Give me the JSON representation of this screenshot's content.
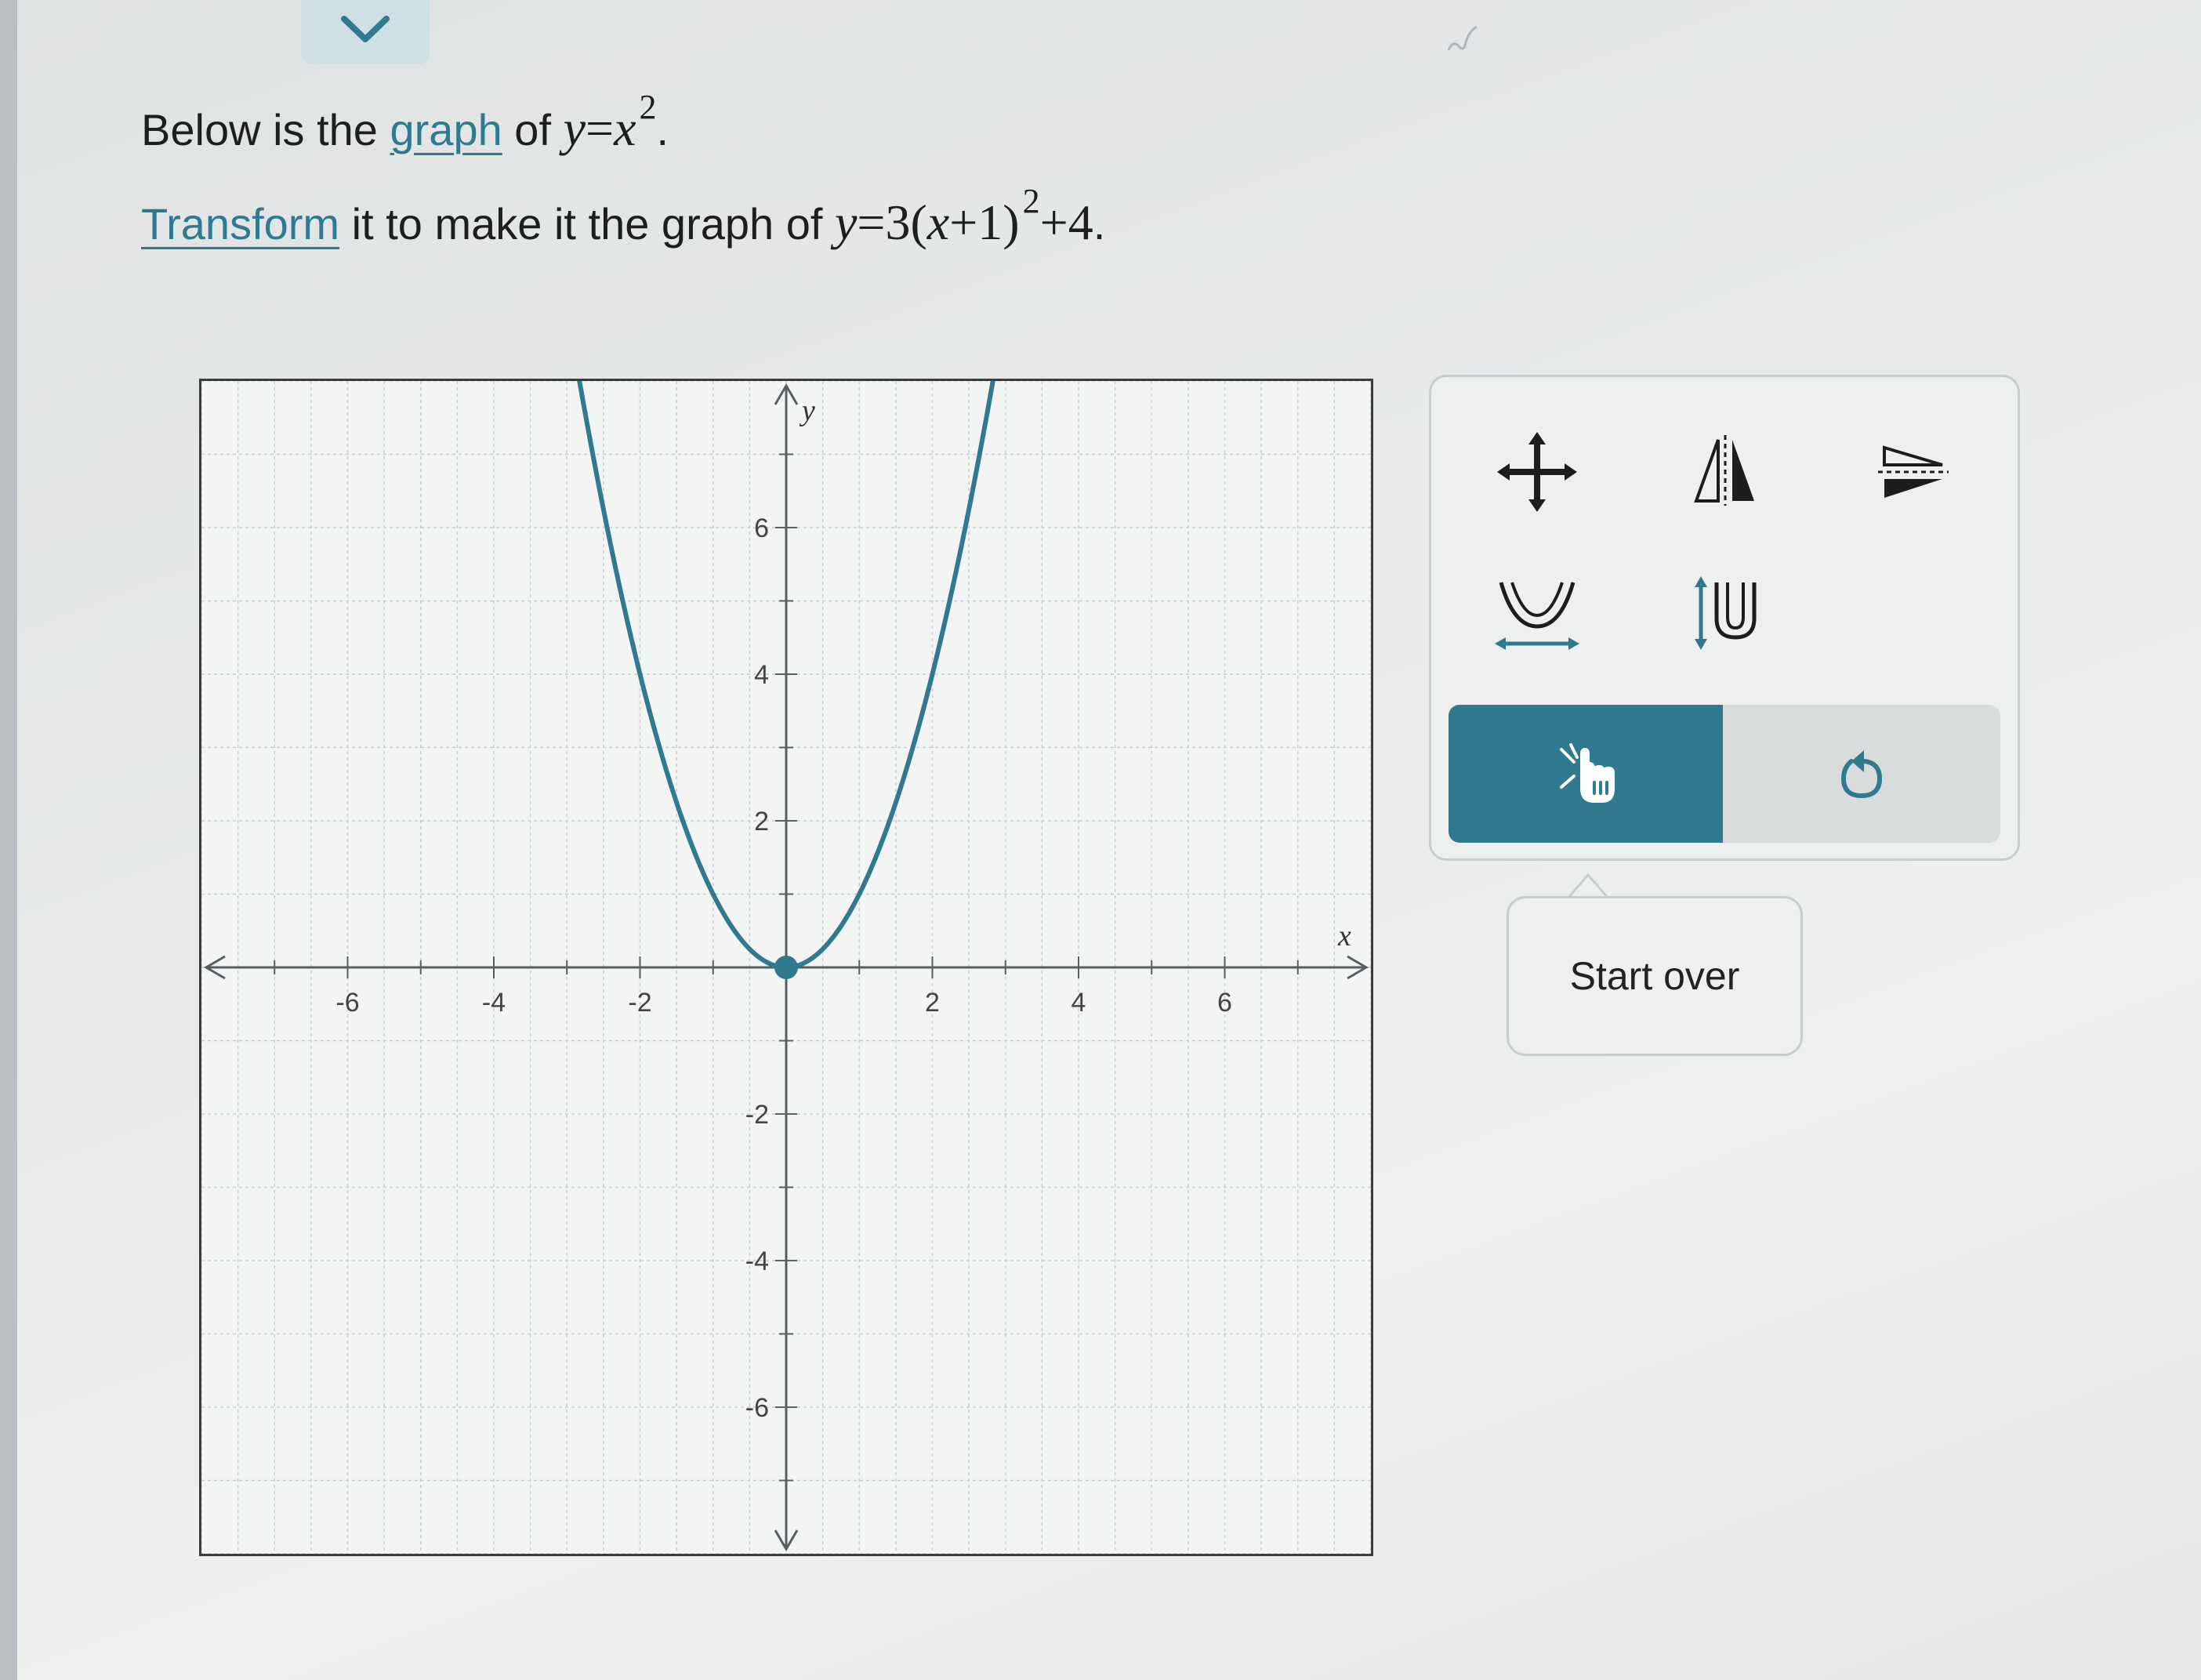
{
  "prompt": {
    "line1": {
      "before": "Below is the ",
      "link": "graph",
      "after": " of ",
      "math_var": "y",
      "math_eq": "=",
      "math_base": "x",
      "math_exp": "2",
      "end": "."
    },
    "line2": {
      "link": "Transform",
      "after": " it to make it the graph of ",
      "math_var": "y",
      "math_eq": "=3(",
      "math_x": "x",
      "math_rest": "+1)",
      "math_exp": "2",
      "math_tail": "+4",
      "end": "."
    }
  },
  "graph": {
    "x_axis_label": "x",
    "y_axis_label": "y",
    "x_ticks": [
      "-6",
      "-4",
      "-2",
      "2",
      "4",
      "6"
    ],
    "y_ticks": [
      "6",
      "4",
      "2",
      "-2",
      "-4",
      "-6"
    ],
    "xlim": [
      -8,
      8
    ],
    "ylim": [
      -8,
      8
    ],
    "curve": {
      "function": "y = x^2",
      "vertex": [
        0,
        0
      ],
      "color": "#2f7a8e"
    },
    "grid": true
  },
  "chart_data": {
    "type": "line",
    "title": "",
    "xlabel": "x",
    "ylabel": "y",
    "xlim": [
      -8,
      8
    ],
    "ylim": [
      -8,
      8
    ],
    "x": [
      -2.7,
      -2,
      -1.5,
      -1,
      -0.5,
      0,
      0.5,
      1,
      1.5,
      2,
      2.7
    ],
    "series": [
      {
        "values": [
          7.29,
          4,
          2.25,
          1,
          0.25,
          0,
          0.25,
          1,
          2.25,
          4,
          7.29
        ]
      }
    ],
    "points": [
      {
        "x": 0,
        "y": 0
      }
    ]
  },
  "tools": {
    "move": "move-icon",
    "reflect_vertical": "reflect-y-axis-icon",
    "reflect_horizontal": "reflect-x-axis-icon",
    "stretch_horizontal": "horizontal-stretch-icon",
    "stretch_vertical": "vertical-stretch-icon",
    "select": "pointer-hand-icon",
    "undo": "undo-icon"
  },
  "tooltip": {
    "label": "Start over"
  },
  "colors": {
    "accent": "#2f7a8e",
    "link": "#2f7a8e",
    "panel": "#eef0f0"
  }
}
